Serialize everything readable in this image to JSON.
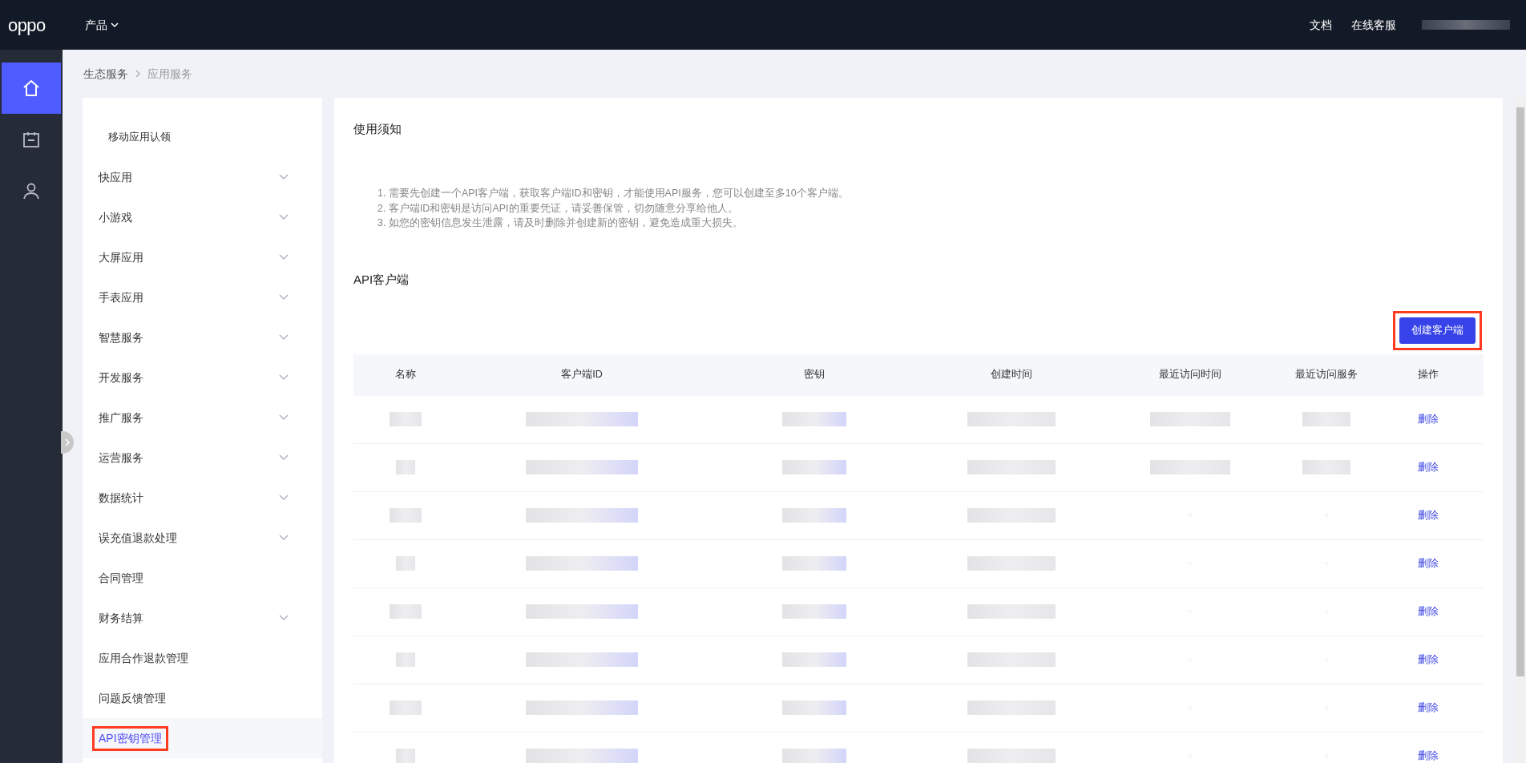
{
  "topbar": {
    "logo": "oppo",
    "product_menu": "产品",
    "links": [
      "文档",
      "在线客服"
    ]
  },
  "rail": {
    "items": [
      {
        "selected": true
      },
      {
        "selected": false
      },
      {
        "selected": false
      }
    ]
  },
  "breadcrumb": [
    "生态服务",
    "应用服务"
  ],
  "sidebar": {
    "items": [
      {
        "label": "移动应用认领",
        "sub": true,
        "expandable": false,
        "selected": false,
        "highlighted": false
      },
      {
        "label": "快应用",
        "sub": false,
        "expandable": true,
        "selected": false,
        "highlighted": false
      },
      {
        "label": "小游戏",
        "sub": false,
        "expandable": true,
        "selected": false,
        "highlighted": false
      },
      {
        "label": "大屏应用",
        "sub": false,
        "expandable": true,
        "selected": false,
        "highlighted": false
      },
      {
        "label": "手表应用",
        "sub": false,
        "expandable": true,
        "selected": false,
        "highlighted": false
      },
      {
        "label": "智慧服务",
        "sub": false,
        "expandable": true,
        "selected": false,
        "highlighted": false
      },
      {
        "label": "开发服务",
        "sub": false,
        "expandable": true,
        "selected": false,
        "highlighted": false
      },
      {
        "label": "推广服务",
        "sub": false,
        "expandable": true,
        "selected": false,
        "highlighted": false
      },
      {
        "label": "运营服务",
        "sub": false,
        "expandable": true,
        "selected": false,
        "highlighted": false
      },
      {
        "label": "数据统计",
        "sub": false,
        "expandable": true,
        "selected": false,
        "highlighted": false
      },
      {
        "label": "误充值退款处理",
        "sub": false,
        "expandable": true,
        "selected": false,
        "highlighted": false
      },
      {
        "label": "合同管理",
        "sub": false,
        "expandable": false,
        "selected": false,
        "highlighted": false
      },
      {
        "label": "财务结算",
        "sub": false,
        "expandable": true,
        "selected": false,
        "highlighted": false
      },
      {
        "label": "应用合作退款管理",
        "sub": false,
        "expandable": false,
        "selected": false,
        "highlighted": false
      },
      {
        "label": "问题反馈管理",
        "sub": false,
        "expandable": false,
        "selected": false,
        "highlighted": false
      },
      {
        "label": "API密钥管理",
        "sub": false,
        "expandable": false,
        "selected": true,
        "highlighted": true
      }
    ]
  },
  "notice": {
    "title": "使用须知",
    "lines": [
      "1. 需要先创建一个API客户端，获取客户端ID和密钥，才能使用API服务，您可以创建至多10个客户端。",
      "2. 客户端ID和密钥是访问API的重要凭证，请妥善保管，切勿随意分享给他人。",
      "3. 如您的密钥信息发生泄露，请及时删除并创建新的密钥，避免造成重大损失。"
    ]
  },
  "clients": {
    "title": "API客户端",
    "create_button": {
      "label": "创建客户端",
      "highlighted": true
    },
    "table": {
      "columns": [
        "名称",
        "客户端ID",
        "密钥",
        "创建时间",
        "最近访问时间",
        "最近访问服务",
        "操作"
      ],
      "rows": [
        {
          "redacted": [
            true,
            true,
            true,
            true,
            true,
            true
          ],
          "action": "删除"
        },
        {
          "redacted": [
            true,
            true,
            true,
            true,
            true,
            true
          ],
          "action": "删除"
        },
        {
          "redacted": [
            true,
            true,
            true,
            true,
            false,
            false
          ],
          "action": "删除"
        },
        {
          "redacted": [
            true,
            true,
            true,
            true,
            false,
            false
          ],
          "action": "删除"
        },
        {
          "redacted": [
            true,
            true,
            true,
            true,
            false,
            false
          ],
          "action": "删除"
        },
        {
          "redacted": [
            true,
            true,
            true,
            true,
            false,
            false
          ],
          "action": "删除"
        },
        {
          "redacted": [
            true,
            true,
            true,
            true,
            false,
            false
          ],
          "action": "删除"
        },
        {
          "redacted": [
            true,
            true,
            true,
            true,
            false,
            false
          ],
          "action": "删除"
        }
      ]
    }
  }
}
